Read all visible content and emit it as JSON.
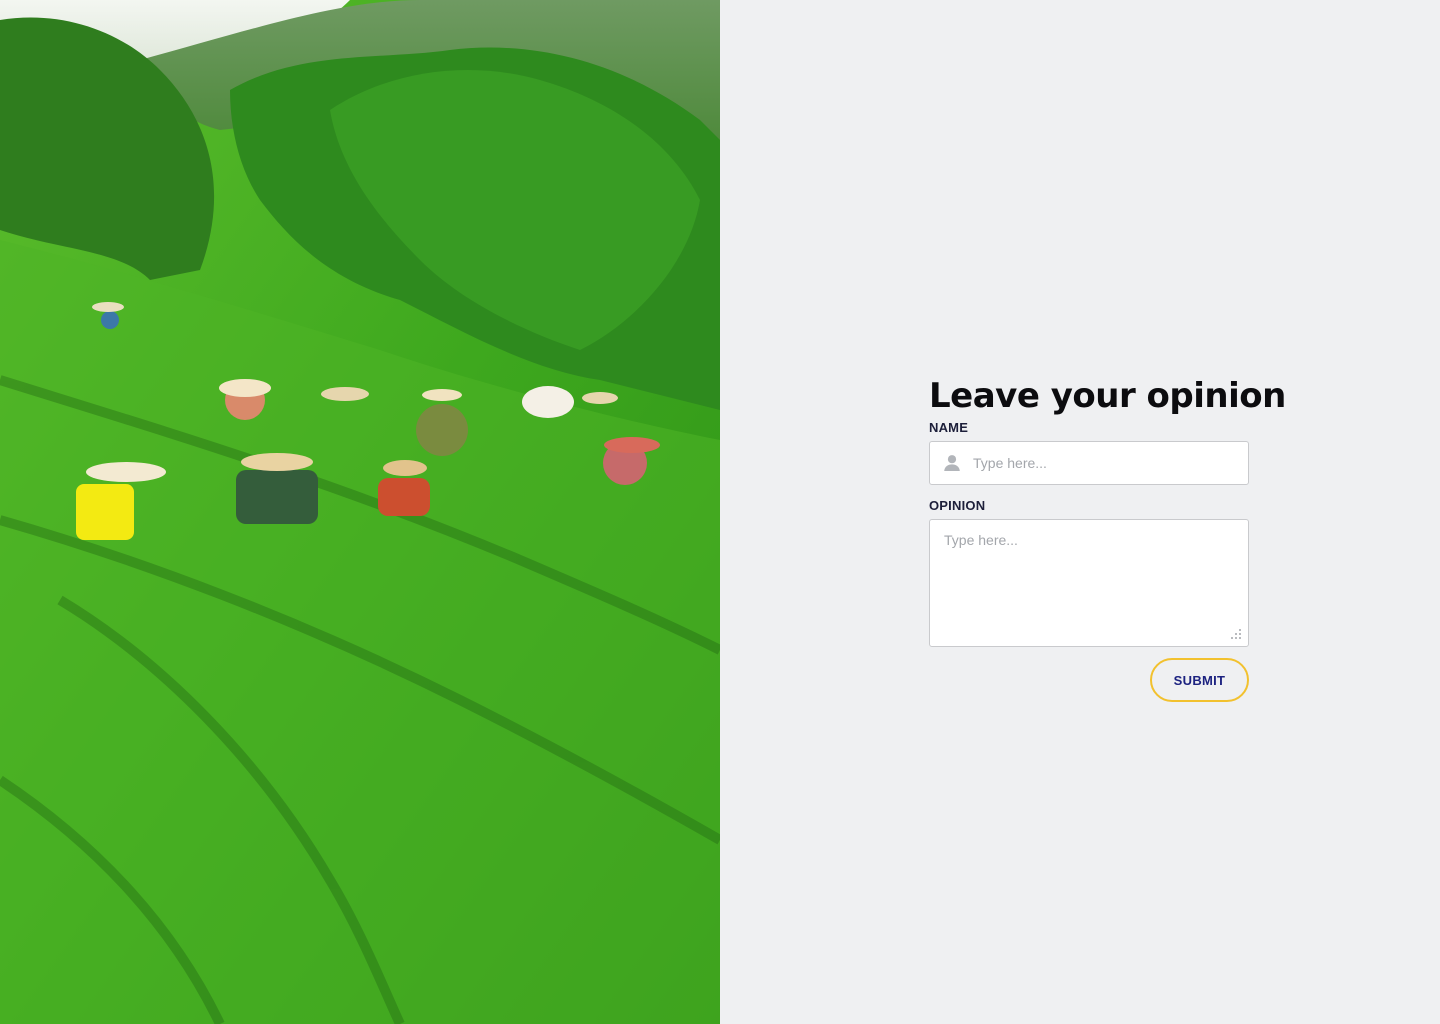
{
  "hero": {
    "image_description": "tea-plantation-photo"
  },
  "form": {
    "title": "Leave your opinion",
    "name_label": "NAME",
    "name_placeholder": "Type here...",
    "name_icon": "user-icon",
    "opinion_label": "OPINION",
    "opinion_placeholder": "Type here...",
    "submit_label": "SUBMIT"
  },
  "colors": {
    "background": "#eff0f2",
    "title": "#0c0c0f",
    "label": "#1d1f3a",
    "submit_border": "#f2c12e",
    "submit_text": "#1c2280"
  }
}
